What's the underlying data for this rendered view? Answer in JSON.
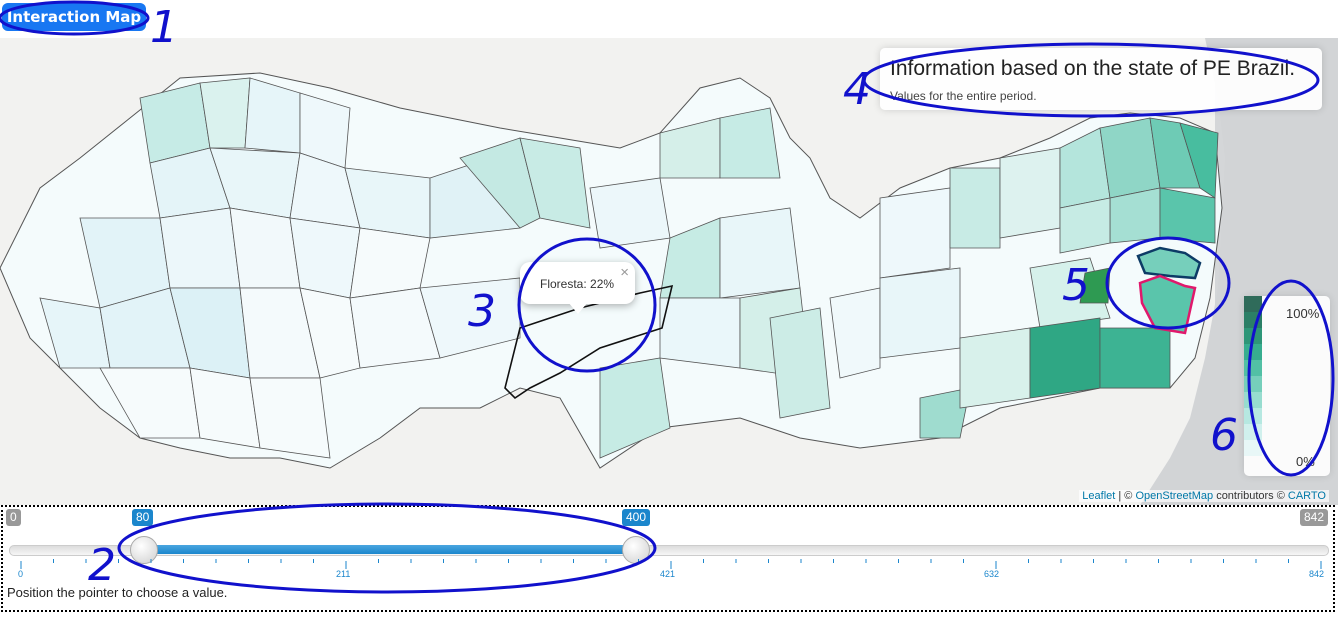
{
  "tab": {
    "label": "Interaction Map"
  },
  "info": {
    "title": "Information based on the state of PE Brazil.",
    "subtitle": "Values for the entire period."
  },
  "popup": {
    "text": "Floresta: 22%",
    "close": "×"
  },
  "legend": {
    "max": "100%",
    "min": "0%",
    "colors": [
      "#e8f7f7",
      "#d0f0ed",
      "#b6e8e1",
      "#97dccf",
      "#76cfbb",
      "#52c0a5",
      "#37ad8f",
      "#2e9678",
      "#2b7f66",
      "#2f6b5a"
    ]
  },
  "attribution": {
    "leaflet": "Leaflet",
    "osm": "OpenStreetMap",
    "contrib": "contributors ©",
    "carto": "CARTO",
    "sep": "| ©"
  },
  "slider": {
    "min": "0",
    "max": "842",
    "from": "80",
    "to": "400",
    "from_value": 80,
    "to_value": 400,
    "range_min": 0,
    "range_max": 842,
    "ticks": [
      "0",
      "211",
      "421",
      "632",
      "842"
    ],
    "hint": "Position the pointer to choose a value."
  },
  "annotations": {
    "a1": "1",
    "a2": "2",
    "a3": "3",
    "a4": "4",
    "a5": "5",
    "a6": "6"
  },
  "colors": {
    "accent": "#1877f2",
    "annotation": "#1111cc",
    "highlight_a": "#0d3b66",
    "highlight_b": "#e0186c"
  }
}
